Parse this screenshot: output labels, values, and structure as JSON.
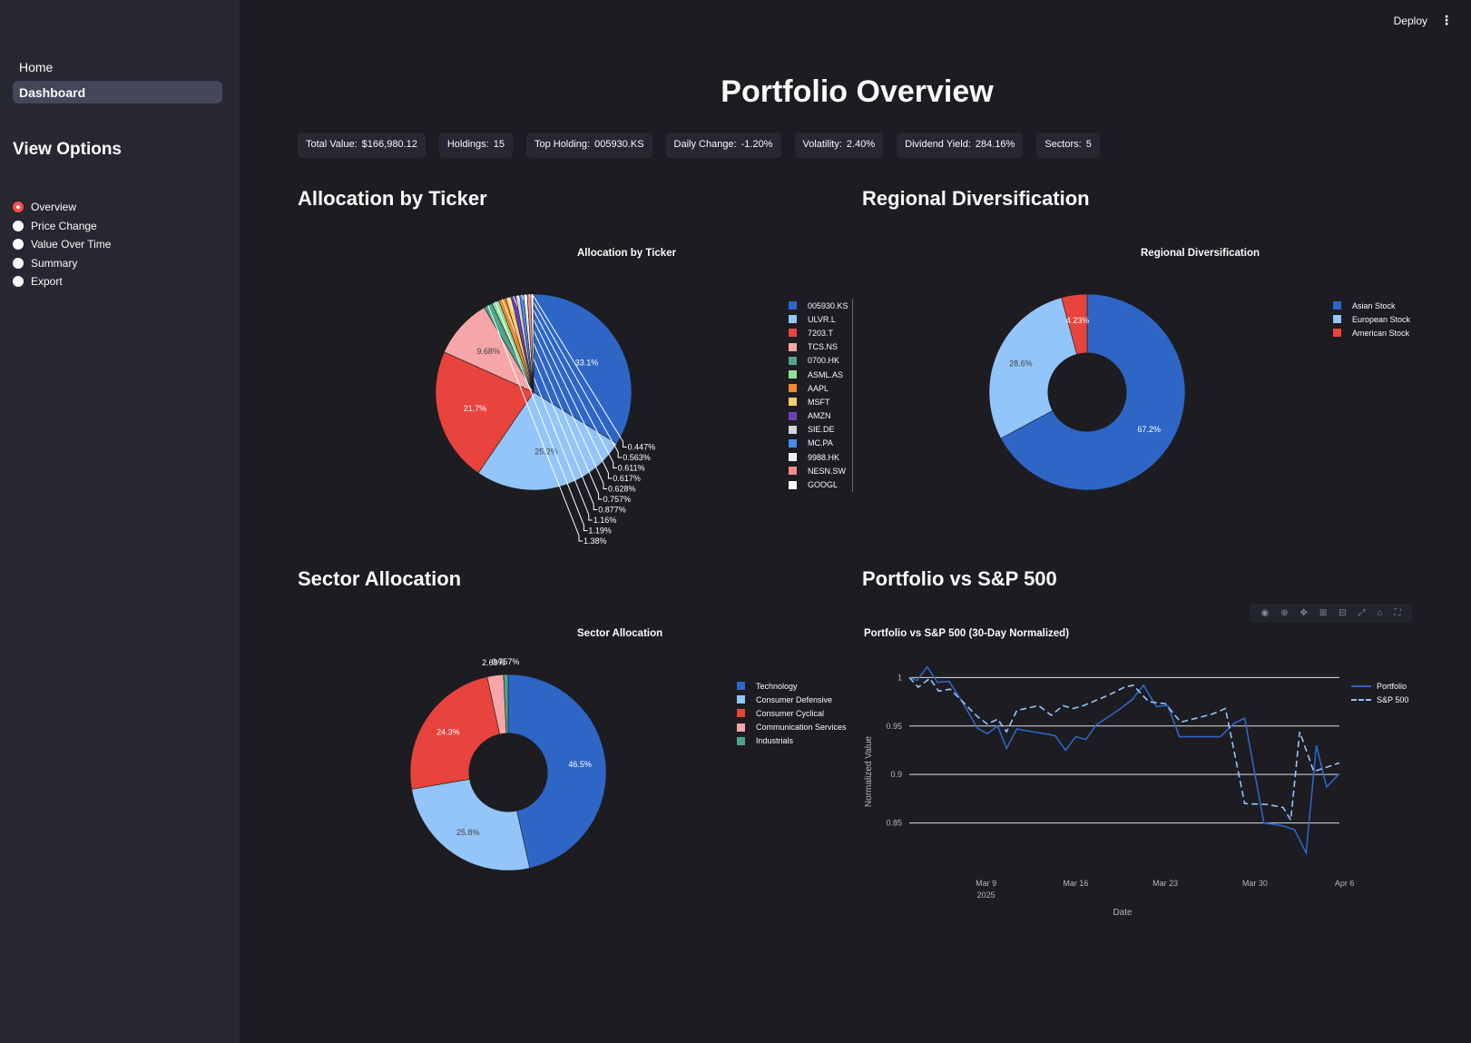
{
  "sidebar": {
    "nav": [
      {
        "label": "Home"
      },
      {
        "label": "Dashboard"
      }
    ],
    "heading": "View Options",
    "options": [
      {
        "label": "Overview",
        "selected": true
      },
      {
        "label": "Price Change",
        "selected": false
      },
      {
        "label": "Value Over Time",
        "selected": false
      },
      {
        "label": "Summary",
        "selected": false
      },
      {
        "label": "Export",
        "selected": false
      }
    ]
  },
  "header": {
    "deploy_label": "Deploy",
    "menu_icon": "kebab-menu-icon"
  },
  "page_title": "Portfolio Overview",
  "metrics": [
    {
      "label": "Total Value:",
      "value": "$166,980.12"
    },
    {
      "label": "Holdings:",
      "value": "15"
    },
    {
      "label": "Top Holding:",
      "value": "005930.KS"
    },
    {
      "label": "Daily Change:",
      "value": "-1.20%"
    },
    {
      "label": "Volatility:",
      "value": "2.40%"
    },
    {
      "label": "Dividend Yield:",
      "value": "284.16%"
    },
    {
      "label": "Sectors:",
      "value": "5"
    }
  ],
  "sections": {
    "ticker": "Allocation by Ticker",
    "region": "Regional Diversification",
    "sector": "Sector Allocation",
    "compare": "Portfolio vs S&P 500"
  },
  "modebar_icons": [
    "camera-icon",
    "zoom-icon",
    "pan-icon",
    "zoom-in-icon",
    "zoom-out-icon",
    "autoscale-icon",
    "reset-axes-icon",
    "fullscreen-icon"
  ],
  "chart_data": [
    {
      "type": "pie",
      "title": "Allocation by Ticker",
      "hole": 0,
      "slices": [
        {
          "label": "005930.KS",
          "value": 33.1,
          "text": "33.1%",
          "color": "#2e66c5"
        },
        {
          "label": "ULVR.L",
          "value": 25.2,
          "text": "25.2%",
          "color": "#93c5fa"
        },
        {
          "label": "7203.T",
          "value": 21.7,
          "text": "21.7%",
          "color": "#e8433c"
        },
        {
          "label": "TCS.NS",
          "value": 9.68,
          "text": "9.68%",
          "color": "#f6a5a8"
        },
        {
          "label": "0700.HK",
          "value": 1.38,
          "text": "1.38%",
          "color": "#4fa48c"
        },
        {
          "label": "ASML.AS",
          "value": 1.19,
          "text": "1.19%",
          "color": "#8ce29a"
        },
        {
          "label": "AAPL",
          "value": 1.16,
          "text": "1.16%",
          "color": "#ef8a30"
        },
        {
          "label": "MSFT",
          "value": 0.877,
          "text": "0.877%",
          "color": "#f3cf6e"
        },
        {
          "label": "AMZN",
          "value": 0.757,
          "text": "0.757%",
          "color": "#6a42b8"
        },
        {
          "label": "SIE.DE",
          "value": 0.628,
          "text": "0.628%",
          "color": "#d2d4dc"
        },
        {
          "label": "MC.PA",
          "value": 0.617,
          "text": "0.617%",
          "color": "#4a8ae8"
        },
        {
          "label": "9988.HK",
          "value": 0.611,
          "text": "0.611%",
          "color": "#e8f0f8"
        },
        {
          "label": "NESN.SW",
          "value": 0.563,
          "text": "0.563%",
          "color": "#f08c8c"
        },
        {
          "label": "GOOGL",
          "value": 0.447,
          "text": "0.447%",
          "color": "#ffffff"
        }
      ]
    },
    {
      "type": "pie",
      "title": "Regional Diversification",
      "hole": 0.4,
      "slices": [
        {
          "label": "Asian Stock",
          "value": 67.2,
          "text": "67.2%",
          "color": "#2e66c5"
        },
        {
          "label": "European Stock",
          "value": 28.6,
          "text": "28.6%",
          "color": "#93c5fa"
        },
        {
          "label": "American Stock",
          "value": 4.23,
          "text": "4.23%",
          "color": "#e8433c"
        }
      ]
    },
    {
      "type": "pie",
      "title": "Sector Allocation",
      "hole": 0.4,
      "slices": [
        {
          "label": "Technology",
          "value": 46.5,
          "text": "46.5%",
          "color": "#2e66c5"
        },
        {
          "label": "Consumer Defensive",
          "value": 25.8,
          "text": "25.8%",
          "color": "#93c5fa"
        },
        {
          "label": "Consumer Cyclical",
          "value": 24.3,
          "text": "24.3%",
          "color": "#e8433c"
        },
        {
          "label": "Communication Services",
          "value": 2.69,
          "text": "2.69%",
          "color": "#f6a5a8"
        },
        {
          "label": "Industrials",
          "value": 0.757,
          "text": "0.757%",
          "color": "#4fa48c"
        }
      ]
    },
    {
      "type": "line",
      "title": "Portfolio vs S&P 500 (30-Day Normalized)",
      "xlabel": "Date",
      "ylabel": "Normalized Value",
      "ylim": [
        0.8,
        1.02
      ],
      "yticks": [
        0.85,
        0.9,
        0.95,
        1
      ],
      "xticks": [
        {
          "label": "Mar 9",
          "sub": "2025",
          "x": 8
        },
        {
          "label": "Mar 16",
          "sub": "",
          "x": 15
        },
        {
          "label": "Mar 23",
          "sub": "",
          "x": 22
        },
        {
          "label": "Mar 30",
          "sub": "",
          "x": 29
        },
        {
          "label": "Apr 6",
          "sub": "",
          "x": 36
        }
      ],
      "series": [
        {
          "name": "Portfolio",
          "color": "#2e66c5",
          "dash": false,
          "values": [
            [
              2,
              1.0
            ],
            [
              2.6,
              0.997
            ],
            [
              3.4,
              1.011
            ],
            [
              4.2,
              0.995
            ],
            [
              5.1,
              0.996
            ],
            [
              6.1,
              0.976
            ],
            [
              7.3,
              0.948
            ],
            [
              8.1,
              0.942
            ],
            [
              8.9,
              0.95
            ],
            [
              9.6,
              0.927
            ],
            [
              10.4,
              0.947
            ],
            [
              13.4,
              0.94
            ],
            [
              14.2,
              0.925
            ],
            [
              15,
              0.939
            ],
            [
              15.8,
              0.936
            ],
            [
              16.6,
              0.951
            ],
            [
              18.4,
              0.967
            ],
            [
              19.4,
              0.977
            ],
            [
              20.3,
              0.992
            ],
            [
              21.3,
              0.97
            ],
            [
              22.2,
              0.971
            ],
            [
              23.1,
              0.939
            ],
            [
              26.3,
              0.939
            ],
            [
              27.4,
              0.953
            ],
            [
              28.2,
              0.958
            ],
            [
              29.7,
              0.85
            ],
            [
              31.2,
              0.847
            ],
            [
              32.1,
              0.843
            ],
            [
              33,
              0.819
            ],
            [
              33.8,
              0.93
            ],
            [
              34.6,
              0.887
            ],
            [
              35.6,
              0.901
            ]
          ]
        },
        {
          "name": "S&P 500",
          "color": "#93c5fa",
          "dash": true,
          "values": [
            [
              2,
              1.0
            ],
            [
              2.7,
              0.99
            ],
            [
              3.6,
              0.999
            ],
            [
              4.3,
              0.986
            ],
            [
              5.2,
              0.988
            ],
            [
              6.1,
              0.976
            ],
            [
              7.3,
              0.96
            ],
            [
              8.1,
              0.952
            ],
            [
              8.9,
              0.957
            ],
            [
              9.6,
              0.944
            ],
            [
              10.4,
              0.966
            ],
            [
              12.1,
              0.971
            ],
            [
              13.1,
              0.961
            ],
            [
              14,
              0.971
            ],
            [
              14.8,
              0.968
            ],
            [
              15.6,
              0.971
            ],
            [
              17.6,
              0.982
            ],
            [
              18.8,
              0.99
            ],
            [
              19.5,
              0.992
            ],
            [
              20.7,
              0.975
            ],
            [
              22,
              0.973
            ],
            [
              23.2,
              0.954
            ],
            [
              25.6,
              0.962
            ],
            [
              26.7,
              0.968
            ],
            [
              28.2,
              0.87
            ],
            [
              30,
              0.869
            ],
            [
              31.2,
              0.866
            ],
            [
              31.8,
              0.853
            ],
            [
              32.5,
              0.944
            ],
            [
              33.6,
              0.903
            ],
            [
              35.6,
              0.912
            ]
          ]
        }
      ]
    }
  ]
}
